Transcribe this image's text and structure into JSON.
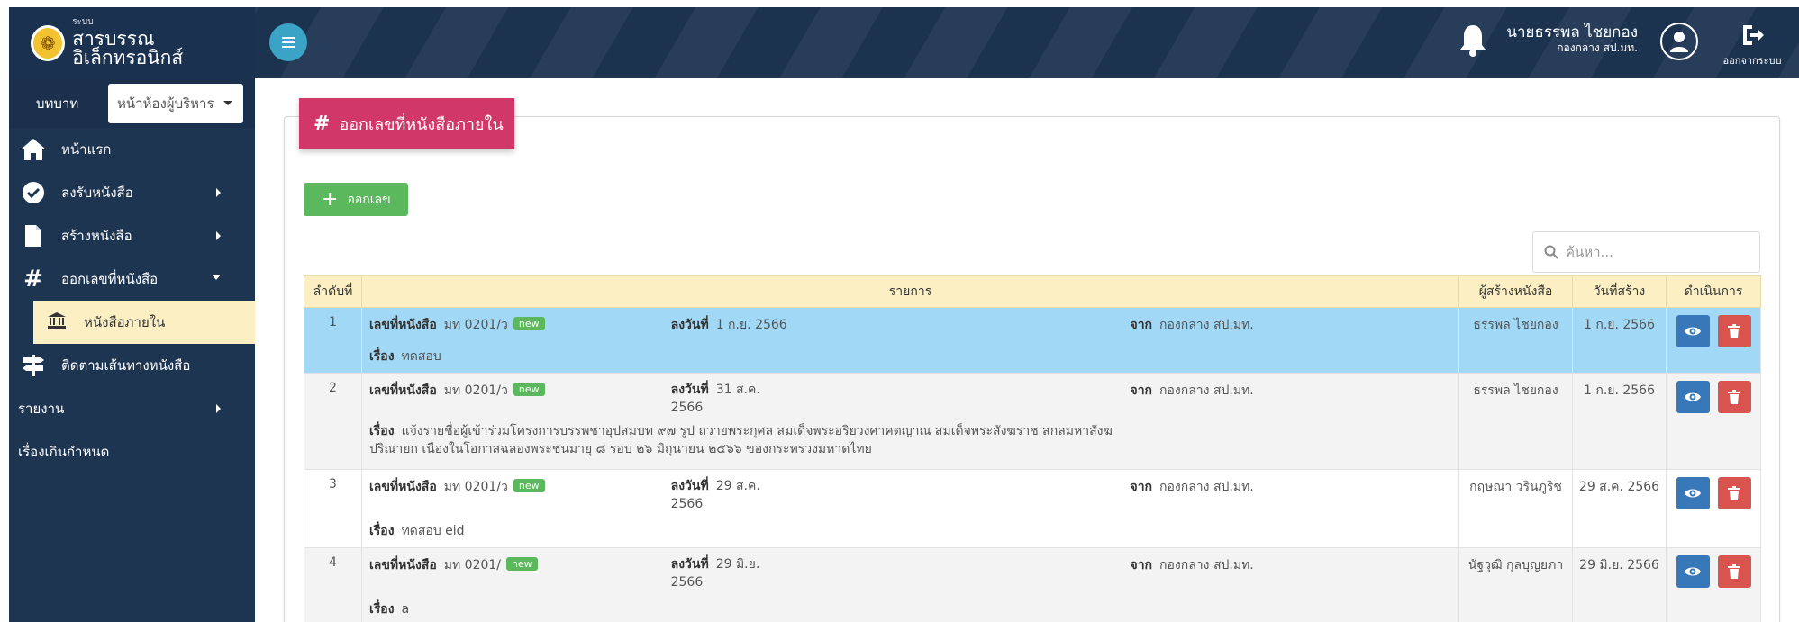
{
  "header": {
    "brand_small": "ระบบ",
    "brand_title": "สารบรรณอิเล็กทรอนิกส์",
    "user_name": "นายธรรพล ไชยกอง",
    "user_dept": "กองกลาง สป.มท.",
    "logout_label": "ออกจากระบบ"
  },
  "sidebar": {
    "role_label": "บทบาท",
    "role_value": "หน้าห้องผู้บริหาร",
    "items": [
      {
        "label": "หน้าแรก"
      },
      {
        "label": "ลงรับหนังสือ"
      },
      {
        "label": "สร้างหนังสือ"
      },
      {
        "label": "ออกเลขที่หนังสือ"
      },
      {
        "label": "หนังสือภายใน"
      },
      {
        "label": "ติดตามเส้นทางหนังสือ"
      },
      {
        "label": "รายงาน"
      },
      {
        "label": "เรื่องเกินกำหนด"
      }
    ]
  },
  "panel": {
    "title": "ออกเลขที่หนังสือภายใน",
    "add_label": "ออกเลข",
    "search_placeholder": "ค้นหา..."
  },
  "table": {
    "headers": [
      "ลำดับที่",
      "รายการ",
      "ผู้สร้างหนังสือ",
      "วันที่สร้าง",
      "ดำเนินการ"
    ],
    "lbl_no": "เลขที่หนังสือ",
    "lbl_date": "ลงวันที่",
    "lbl_from": "จาก",
    "lbl_subject": "เรื่อง",
    "badge": "new",
    "rows": [
      {
        "seq": "1",
        "doc_no": "มท 0201/ว",
        "date": "1 ก.ย. 2566",
        "from": "กองกลาง สป.มท.",
        "subject": "ทดสอบ",
        "creator": "ธรรพล ไชยกอง",
        "created": "1 ก.ย. 2566"
      },
      {
        "seq": "2",
        "doc_no": "มท 0201/ว",
        "date": "31 ส.ค. 2566",
        "from": "กองกลาง สป.มท.",
        "subject": "แจ้งรายชื่อผู้เข้าร่วมโครงการบรรพชาอุปสมบท ๙๗ รูป ถวายพระกุศล สมเด็จพระอริยวงศาคตญาณ สมเด็จพระสังฆราช สกลมหาสังฆปริณายก เนื่องในโอกาสฉลองพระชนมายุ ๘ รอบ ๒๖ มิถุนายน ๒๕๖๖ ของกระทรวงมหาดไทย",
        "creator": "ธรรพล ไชยกอง",
        "created": "1 ก.ย. 2566"
      },
      {
        "seq": "3",
        "doc_no": "มท 0201/ว",
        "date": "29 ส.ค. 2566",
        "from": "กองกลาง สป.มท.",
        "subject": "ทดสอบ eid",
        "creator": "กฤษณา วรินภูริช",
        "created": "29 ส.ค. 2566"
      },
      {
        "seq": "4",
        "doc_no": "มท 0201/",
        "date": "29 มิ.ย. 2566",
        "from": "กองกลาง สป.มท.",
        "subject": "a",
        "creator": "นัฐวุฒิ กุลบุญยภา",
        "created": "29 มิ.ย. 2566"
      }
    ]
  }
}
